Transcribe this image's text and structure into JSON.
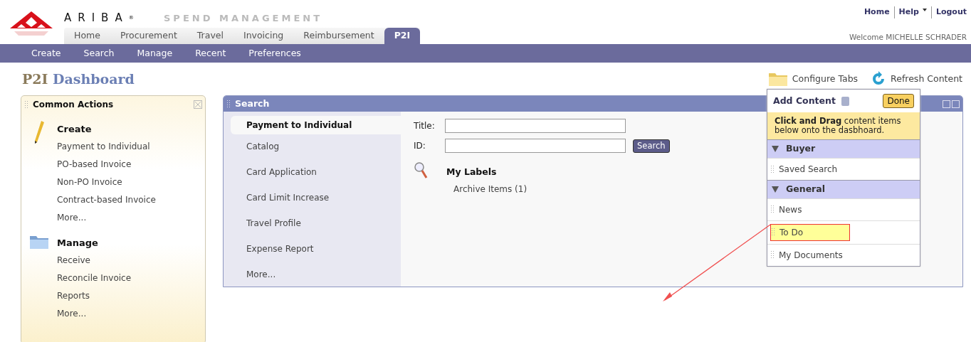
{
  "brand": {
    "logo_text": "ARIBA",
    "registered": "®",
    "product": "SPEND MANAGEMENT"
  },
  "top_links": [
    {
      "label": "Home",
      "dropdown": false
    },
    {
      "label": "Help",
      "dropdown": true
    },
    {
      "label": "Logout",
      "dropdown": false
    }
  ],
  "welcome": "Welcome MICHELLE SCHRADER",
  "tabs": [
    {
      "label": "Home",
      "selected": false
    },
    {
      "label": "Procurement",
      "selected": false
    },
    {
      "label": "Travel",
      "selected": false
    },
    {
      "label": "Invoicing",
      "selected": false
    },
    {
      "label": "Reimbursement",
      "selected": false
    },
    {
      "label": "P2I",
      "selected": true
    }
  ],
  "subnav": [
    "Create",
    "Search",
    "Manage",
    "Recent",
    "Preferences"
  ],
  "page_title": {
    "prefix": "P2I",
    "title": "Dashboard"
  },
  "toolbar": [
    {
      "label": "Configure Tabs",
      "kind": "folder"
    },
    {
      "label": "Refresh Content",
      "kind": "refresh"
    }
  ],
  "common_actions": {
    "title": "Common Actions",
    "sections": [
      {
        "title": "Create",
        "kind": "pencil",
        "links": [
          "Payment to Individual",
          "PO-based Invoice",
          "Non-PO Invoice",
          "Contract-based Invoice",
          "More..."
        ]
      },
      {
        "title": "Manage",
        "kind": "folder",
        "links": [
          "Receive",
          "Reconcile Invoice",
          "Reports",
          "More..."
        ]
      }
    ]
  },
  "search_panel": {
    "title": "Search",
    "categories": [
      {
        "label": "Payment to Individual",
        "selected": true
      },
      {
        "label": "Catalog",
        "selected": false
      },
      {
        "label": "Card Application",
        "selected": false
      },
      {
        "label": "Card Limit Increase",
        "selected": false
      },
      {
        "label": "Travel Profile",
        "selected": false
      },
      {
        "label": "Expense Report",
        "selected": false
      },
      {
        "label": "More...",
        "selected": false
      }
    ],
    "fields": [
      {
        "label": "Title:"
      },
      {
        "label": "ID:"
      }
    ],
    "search_button": "Search",
    "labels_heading": "My Labels",
    "label_items": [
      "Archive Items (1)"
    ]
  },
  "add_content": {
    "title": "Add Content",
    "done_button": "Done",
    "instructions": "**Click and Drag** content items below onto the dasbhoard.",
    "groups": [
      {
        "name": "Buyer",
        "expanded": true,
        "items": [
          {
            "label": "Saved Search",
            "highlighted": false
          }
        ]
      },
      {
        "name": "General",
        "expanded": true,
        "items": [
          {
            "label": "News",
            "highlighted": false
          },
          {
            "label": "To Do",
            "highlighted": true
          },
          {
            "label": "My Documents",
            "highlighted": false
          }
        ]
      }
    ]
  }
}
